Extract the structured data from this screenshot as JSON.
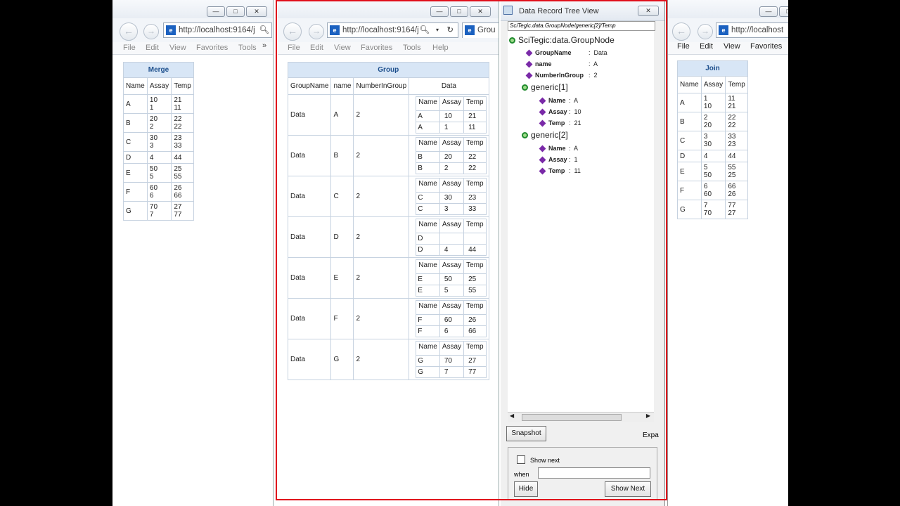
{
  "browser_common": {
    "menu": [
      "File",
      "Edit",
      "View",
      "Favorites",
      "Tools",
      "Help"
    ],
    "url_left": "http://localhost:9164/j",
    "url_mid": "http://localhost:9164/j",
    "url_right": "http://localhost",
    "tab_title": "Grou",
    "min": "—",
    "max": "□",
    "close": "✕",
    "back": "←",
    "fwd": "→"
  },
  "merge": {
    "title": "Merge",
    "headers": [
      "Name",
      "Assay",
      "Temp"
    ],
    "rows": [
      {
        "name": "A",
        "assay": "10\n1",
        "temp": "21\n11"
      },
      {
        "name": "B",
        "assay": "20\n2",
        "temp": "22\n22"
      },
      {
        "name": "C",
        "assay": "30\n3",
        "temp": "23\n33"
      },
      {
        "name": "D",
        "assay": "4",
        "temp": "44"
      },
      {
        "name": "E",
        "assay": "50\n5",
        "temp": "25\n55"
      },
      {
        "name": "F",
        "assay": "60\n6",
        "temp": "26\n66"
      },
      {
        "name": "G",
        "assay": "70\n7",
        "temp": "27\n77"
      }
    ]
  },
  "group": {
    "title": "Group",
    "headers": [
      "GroupName",
      "name",
      "NumberInGroup",
      "Data"
    ],
    "inner_headers": [
      "Name",
      "Assay",
      "Temp"
    ],
    "rows": [
      {
        "g": "Data",
        "n": "A",
        "c": "2",
        "sub": [
          [
            "A",
            "10",
            "21"
          ],
          [
            "A",
            "1",
            "11"
          ]
        ]
      },
      {
        "g": "Data",
        "n": "B",
        "c": "2",
        "sub": [
          [
            "B",
            "20",
            "22"
          ],
          [
            "B",
            "2",
            "22"
          ]
        ]
      },
      {
        "g": "Data",
        "n": "C",
        "c": "2",
        "sub": [
          [
            "C",
            "30",
            "23"
          ],
          [
            "C",
            "3",
            "33"
          ]
        ]
      },
      {
        "g": "Data",
        "n": "D",
        "c": "2",
        "sub": [
          [
            "D",
            "",
            ""
          ],
          [
            "D",
            "4",
            "44"
          ]
        ]
      },
      {
        "g": "Data",
        "n": "E",
        "c": "2",
        "sub": [
          [
            "E",
            "50",
            "25"
          ],
          [
            "E",
            "5",
            "55"
          ]
        ]
      },
      {
        "g": "Data",
        "n": "F",
        "c": "2",
        "sub": [
          [
            "F",
            "60",
            "26"
          ],
          [
            "F",
            "6",
            "66"
          ]
        ]
      },
      {
        "g": "Data",
        "n": "G",
        "c": "2",
        "sub": [
          [
            "G",
            "70",
            "27"
          ],
          [
            "G",
            "7",
            "77"
          ]
        ]
      }
    ]
  },
  "tree_view": {
    "title": "Data Record Tree View",
    "path": "SciTegic.data.GroupNode/generic[2]/Temp",
    "root": "SciTegic:data.GroupNode",
    "props": [
      {
        "k": "GroupName",
        "v": "Data"
      },
      {
        "k": "name",
        "v": "A"
      },
      {
        "k": "NumberInGroup",
        "v": "2"
      }
    ],
    "generic1": "generic[1]",
    "g1_props": [
      {
        "k": "Name",
        "v": "A"
      },
      {
        "k": "Assay",
        "v": "10"
      },
      {
        "k": "Temp",
        "v": "21"
      }
    ],
    "generic2": "generic[2]",
    "g2_props": [
      {
        "k": "Name",
        "v": "A"
      },
      {
        "k": "Assay",
        "v": "1"
      },
      {
        "k": "Temp",
        "v": "11"
      }
    ],
    "snapshot": "Snapshot",
    "expand": "Expa",
    "show_next_label": "Show next",
    "when_label": "when",
    "hide": "Hide",
    "show_next_btn": "Show Next"
  },
  "join": {
    "title": "Join",
    "headers": [
      "Name",
      "Assay",
      "Temp"
    ],
    "rows": [
      {
        "name": "A",
        "assay": "1\n10",
        "temp": "11\n21"
      },
      {
        "name": "B",
        "assay": "2\n20",
        "temp": "22\n22"
      },
      {
        "name": "C",
        "assay": "3\n30",
        "temp": "33\n23"
      },
      {
        "name": "D",
        "assay": "4",
        "temp": "44"
      },
      {
        "name": "E",
        "assay": "5\n50",
        "temp": "55\n25"
      },
      {
        "name": "F",
        "assay": "6\n60",
        "temp": "66\n26"
      },
      {
        "name": "G",
        "assay": "7\n70",
        "temp": "77\n27"
      }
    ]
  }
}
